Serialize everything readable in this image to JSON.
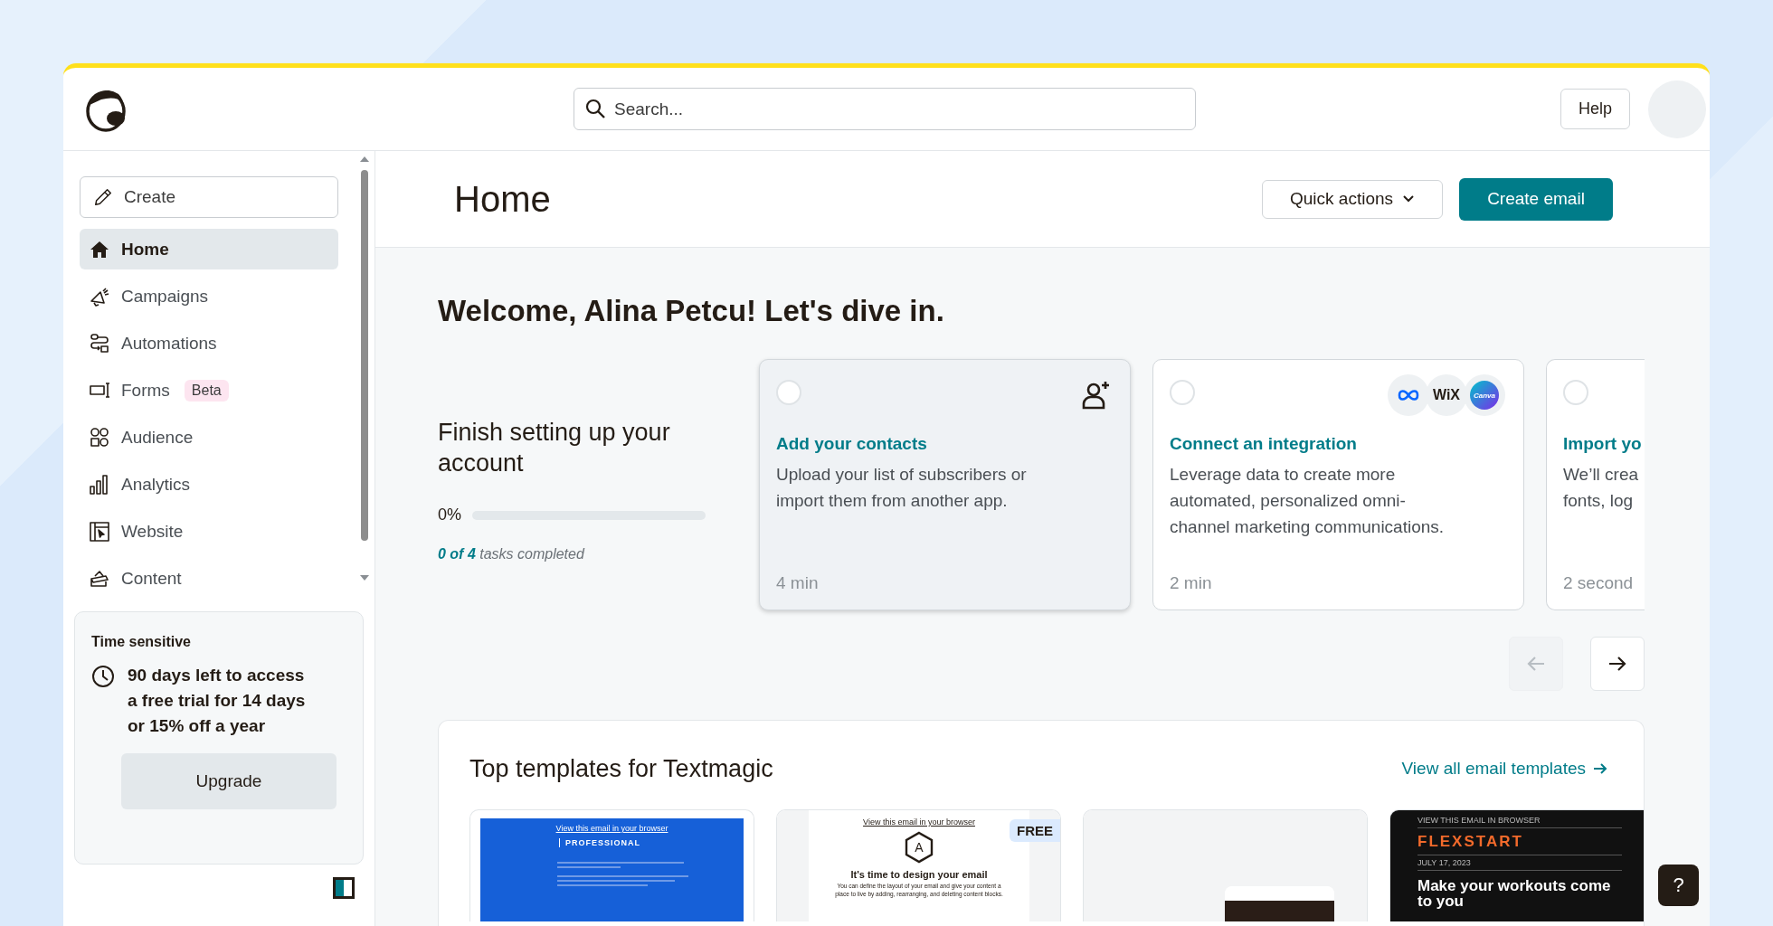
{
  "header": {
    "search": {
      "placeholder": "Search..."
    },
    "help_button": "Help"
  },
  "sidebar": {
    "create_button": "Create",
    "items": [
      {
        "kind": "home",
        "label": "Home",
        "selected": true
      },
      {
        "kind": "megaphone",
        "label": "Campaigns",
        "selected": false
      },
      {
        "kind": "flow",
        "label": "Automations",
        "selected": false
      },
      {
        "kind": "form",
        "label": "Forms",
        "badge": "Beta",
        "selected": false
      },
      {
        "kind": "audience",
        "label": "Audience",
        "selected": false
      },
      {
        "kind": "bars",
        "label": "Analytics",
        "selected": false
      },
      {
        "kind": "website",
        "label": "Website",
        "selected": false
      },
      {
        "kind": "content",
        "label": "Content",
        "selected": false
      }
    ],
    "notice": {
      "title": "Time sensitive",
      "message": "90 days left to access a free trial for 14 days or 15% off a year",
      "button": "Upgrade"
    }
  },
  "page": {
    "title": "Home",
    "quick_actions": "Quick actions",
    "primary_button": "Create email"
  },
  "welcome": "Welcome, Alina Petcu! Let's dive in.",
  "setup": {
    "title": "Finish setting up your account",
    "percent": "0%",
    "level": 0,
    "summary": "**0 of 4** tasks completed",
    "tasks": [
      {
        "kind": "contacts",
        "completed": false,
        "highlighted": true,
        "title": "Add your contacts",
        "description": [
          "Upload your list of subscribers or",
          "import them from another app."
        ],
        "time": "4 min"
      },
      {
        "kind": "integrations",
        "completed": false,
        "highlighted": false,
        "title": "Connect an integration",
        "logos": [
          {
            "kind": "infinity"
          },
          {
            "kind": "wordmark",
            "text": "WiX"
          },
          {
            "kind": "gradient",
            "text": "Canva"
          }
        ],
        "description": [
          "Leverage data to create more",
          "automated, personalized omni-",
          "channel marketing communications."
        ],
        "time": "2 min"
      },
      {
        "kind": "brand",
        "completed": false,
        "highlighted": false,
        "title": "Import yo",
        "description": [
          "We’ll crea",
          "fonts, log"
        ],
        "time": "2 second"
      }
    ],
    "prev_disabled": true,
    "next_disabled": false
  },
  "templates": {
    "title": "Top templates for Textmagic",
    "link": "View all email templates",
    "items": [
      {
        "kind": "professional",
        "browser_link": "View this email in your browser",
        "heading": "PROFESSIONAL"
      },
      {
        "kind": "hexagon",
        "badge": "FREE",
        "browser_link": "View this email in your browser",
        "emblem": "A",
        "heading": "It's time to design your email",
        "body": "You can define the layout of your email and give your content a place to live by adding, rearranging, and deleting content blocks."
      },
      {
        "kind": "blank"
      },
      {
        "kind": "dark",
        "browser_link": "VIEW THIS EMAIL IN BROWSER",
        "brand": "FLEXSTART",
        "date": "JULY 17, 2023",
        "heading": "Make your workouts come to you"
      }
    ]
  },
  "help_fab": "?"
}
